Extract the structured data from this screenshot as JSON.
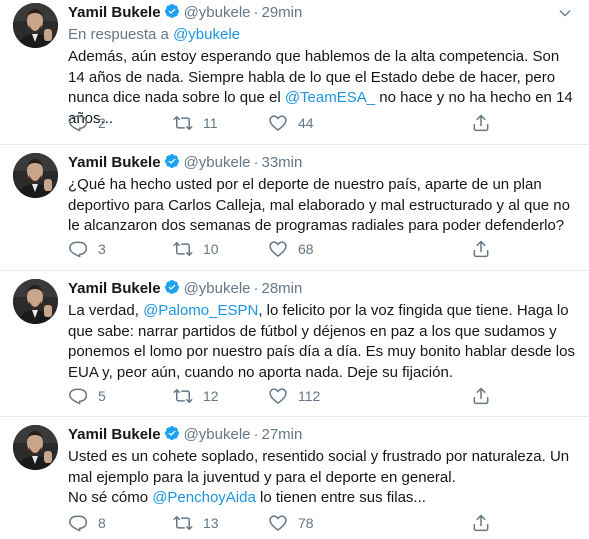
{
  "tweets": [
    {
      "name": "Yamil Bukele",
      "handle": "@ybukele",
      "dot": "·",
      "time": "29min",
      "reply_prefix": "En respuesta a ",
      "reply_handle": "@ybukele",
      "text_a": "Además, aún estoy esperando que hablemos de la alta competencia. Son 14 años de nada. Siempre habla de lo que el Estado debe de hacer, pero nunca dice nada sobre lo que el ",
      "mention": "@TeamESA_",
      "text_b": " no hace y  no ha hecho en 14 años...",
      "replies": "2",
      "retweets": "11",
      "likes": "44"
    },
    {
      "name": "Yamil Bukele",
      "handle": "@ybukele",
      "dot": "·",
      "time": "33min",
      "text_a": "¿Qué ha hecho usted por el deporte de nuestro país, aparte de un plan deportivo para Carlos Calleja, mal elaborado y mal estructurado y al que no le alcanzaron dos semanas de programas radiales para poder defenderlo?",
      "replies": "3",
      "retweets": "10",
      "likes": "68"
    },
    {
      "name": "Yamil Bukele",
      "handle": "@ybukele",
      "dot": "·",
      "time": "28min",
      "text_a": "La verdad, ",
      "mention": "@Palomo_ESPN",
      "text_b": ", lo felicito por la voz fingida que tiene. Haga lo que sabe: narrar partidos de fútbol y déjenos en paz a los que sudamos y ponemos el lomo por nuestro país día a día. Es muy bonito hablar desde los EUA y, peor aún, cuando no aporta nada. Deje su fijación.",
      "replies": "5",
      "retweets": "12",
      "likes": "112"
    },
    {
      "name": "Yamil Bukele",
      "handle": "@ybukele",
      "dot": "·",
      "time": "27min",
      "text_a": "Usted es un cohete soplado, resentido social y frustrado por naturaleza. Un mal ejemplo para la juventud y para el deporte en general.",
      "text_c": "No sé cómo ",
      "mention": "@PenchoyAida",
      "text_b": " lo tienen entre sus filas...",
      "replies": "8",
      "retweets": "13",
      "likes": "78"
    }
  ],
  "colors": {
    "link": "#1b95e0",
    "verified": "#1da1f2",
    "muted": "#657786",
    "text": "#14171a"
  },
  "icons": [
    "verified-badge-icon",
    "chevron-down-icon",
    "reply-icon",
    "retweet-icon",
    "like-icon",
    "share-icon"
  ]
}
